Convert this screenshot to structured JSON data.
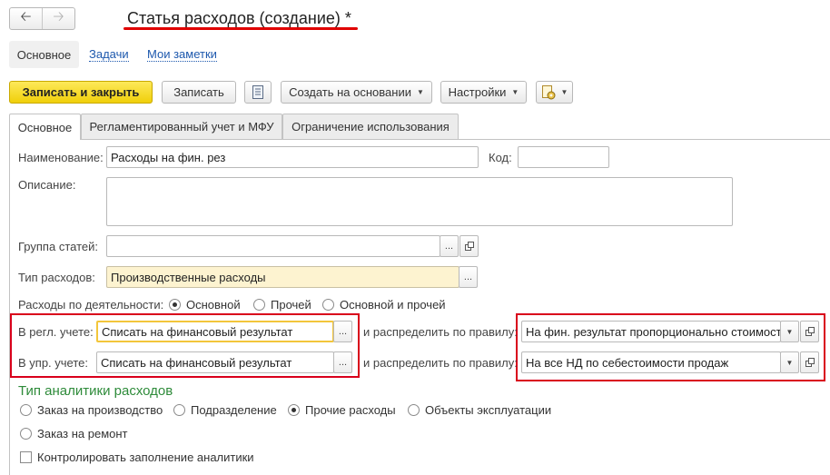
{
  "window": {
    "title": "Статья расходов (создание) *",
    "back_icon": "arrow-left-icon",
    "forward_icon": "arrow-right-icon"
  },
  "nav": {
    "main": "Основное",
    "tasks": "Задачи",
    "notes": "Мои заметки"
  },
  "toolbar": {
    "save_close": "Записать и закрыть",
    "save": "Записать",
    "doc_icon": "document-list-icon",
    "create_based": "Создать на основании",
    "settings": "Настройки",
    "extra_icon": "document-gear-icon"
  },
  "tabs": [
    {
      "label": "Основное"
    },
    {
      "label": "Регламентированный учет и МФУ"
    },
    {
      "label": "Ограничение использования"
    }
  ],
  "form": {
    "name_label": "Наименование:",
    "name_value": "Расходы на фин. рез",
    "code_label": "Код:",
    "code_value": "",
    "description_label": "Описание:",
    "group_label": "Группа статей:",
    "group_value": "",
    "type_label": "Тип расходов:",
    "type_value": "Производственные расходы",
    "activity_label": "Расходы по деятельности:",
    "activity_options": [
      {
        "label": "Основной",
        "checked": true
      },
      {
        "label": "Прочей",
        "checked": false
      },
      {
        "label": "Основной и прочей",
        "checked": false
      }
    ],
    "reg_label": "В регл. учете:",
    "reg_value": "Списать на финансовый результат",
    "mgmt_label": "В упр. учете:",
    "mgmt_value": "Списать на финансовый результат",
    "distribute_label_1": "и распределить по правилу:",
    "distribute_value_1": "На фин. результат пропорционально стоимости",
    "distribute_label_2": "и распределить по правилу:",
    "distribute_value_2": "На все НД по себестоимости продаж"
  },
  "analytics": {
    "title": "Тип аналитики расходов",
    "options": [
      {
        "label": "Заказ на производство",
        "checked": false
      },
      {
        "label": "Подразделение",
        "checked": false
      },
      {
        "label": "Прочие расходы",
        "checked": true
      },
      {
        "label": "Объекты эксплуатации",
        "checked": false
      },
      {
        "label": "Заказ на ремонт",
        "checked": false
      }
    ],
    "control_label": "Контролировать заполнение аналитики",
    "control_checked": false
  },
  "colors": {
    "accent_yellow": "#f3d21f",
    "highlight_red": "#d9001b",
    "section_green": "#2e8b3a",
    "link_blue": "#1d58ad"
  }
}
